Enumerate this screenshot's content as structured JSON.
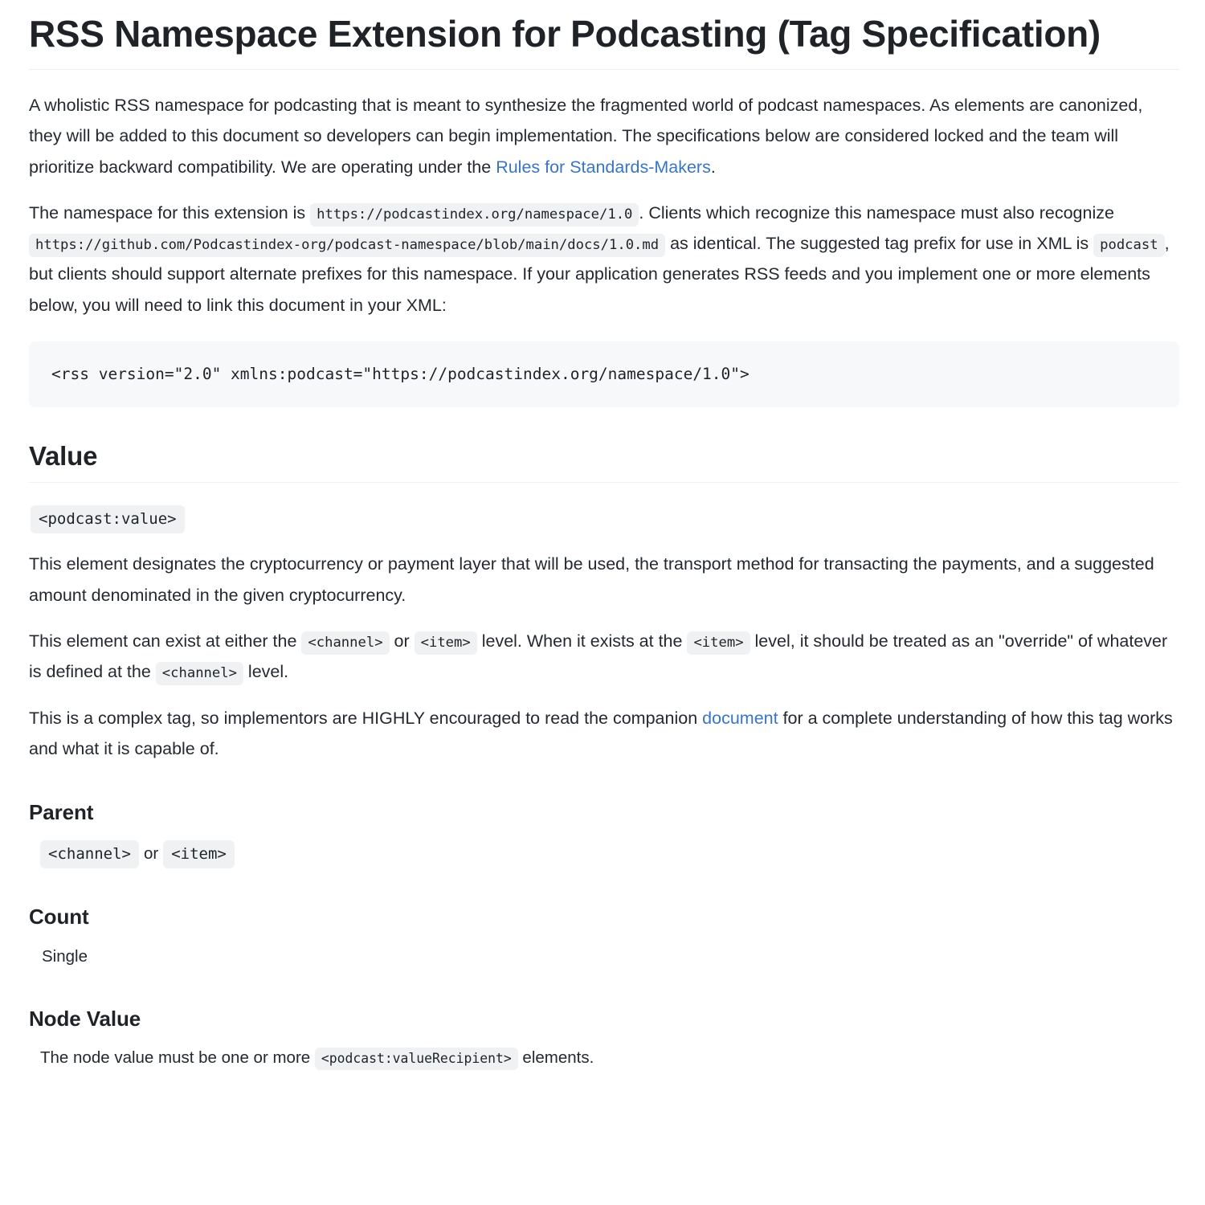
{
  "document": {
    "title": "RSS Namespace Extension for Podcasting (Tag Specification)",
    "intro": {
      "part1": "A wholistic RSS namespace for podcasting that is meant to synthesize the fragmented world of podcast namespaces. As elements are canonized, they will be added to this document so developers can begin implementation. The specifications below are considered locked and the team will prioritize backward compatibility. We are operating under the ",
      "link_rules_label": "Rules for Standards-Makers",
      "part2": "."
    },
    "namespace_para": {
      "s1": "The namespace for this extension is",
      "code_namespace": "https://podcastindex.org/namespace/1.0",
      "s2": ". Clients which recognize this namespace must also recognize",
      "code_github": "https://github.com/Podcastindex-org/podcast-namespace/blob/main/docs/1.0.md",
      "s3": "as identical. The suggested tag prefix for use in XML is",
      "code_prefix": "podcast",
      "s4": ", but clients should support alternate prefixes for this namespace. If your application generates RSS feeds and you implement one or more elements below, you will need to link this document in your XML:"
    },
    "code_block": "<rss version=\"2.0\" xmlns:podcast=\"https://podcastindex.org/namespace/1.0\">"
  },
  "value_section": {
    "heading": "Value",
    "tag_chip": "<podcast:value>",
    "desc_para": "This element designates the cryptocurrency or payment layer that will be used, the transport method for transacting the payments, and a suggested amount denominated in the given cryptocurrency.",
    "level_para": {
      "s1": "This element can exist at either the",
      "code_channel_1": "<channel>",
      "s2": "or",
      "code_item_1": "<item>",
      "s3": "level. When it exists at the",
      "code_item_2": "<item>",
      "s4": "level, it should be treated as an \"override\" of whatever is defined at the",
      "code_channel_2": "<channel>",
      "s5": "level."
    },
    "complex_para": {
      "s1": "This is a complex tag, so implementors are HIGHLY encouraged to read the companion",
      "link_label": "document",
      "s2": "for a complete understanding of how this tag works and what it is capable of."
    },
    "parent": {
      "heading": "Parent",
      "chip_channel": "<channel>",
      "joiner": "or",
      "chip_item": "<item>"
    },
    "count": {
      "heading": "Count",
      "value": "Single"
    },
    "node_value": {
      "heading": "Node Value",
      "s1": "The node value must be one or more",
      "code_chip": "<podcast:valueRecipient>",
      "s2": "elements."
    }
  },
  "colors": {
    "link": "#3876c4",
    "text": "#24292f",
    "chip_bg": "#eff1f3",
    "code_block_bg": "#f6f8fa",
    "rule": "#eef0f2"
  }
}
